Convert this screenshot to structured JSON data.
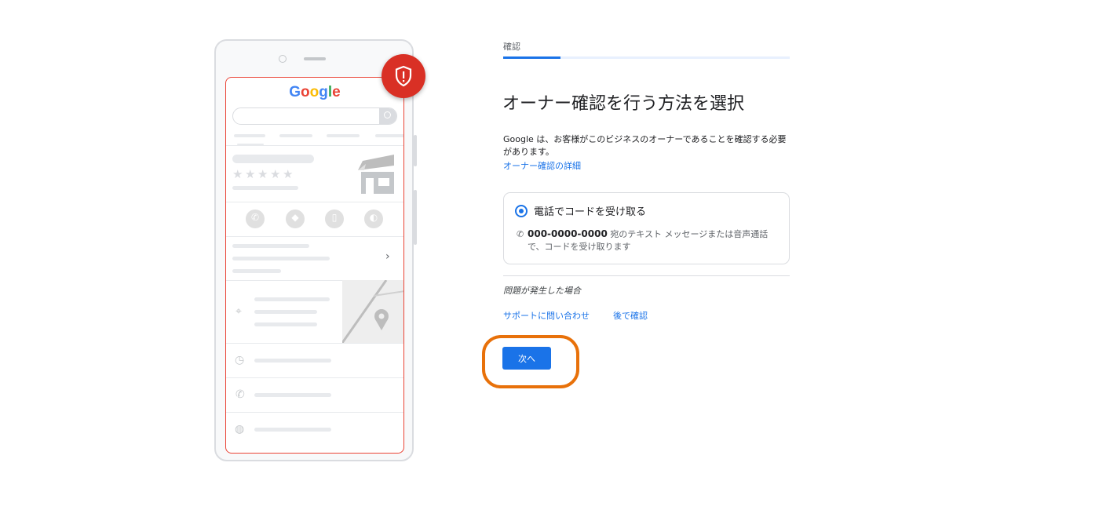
{
  "illustration": {
    "logo_parts": [
      "G",
      "o",
      "o",
      "g",
      "l",
      "e"
    ],
    "stars": [
      "★",
      "★",
      "★",
      "★",
      "★"
    ]
  },
  "verification": {
    "step_label": "確認",
    "progress_value": 0.2,
    "title": "オーナー確認を行う方法を選択",
    "description": "Google は、お客様がこのビジネスのオーナーであることを確認する必要があります。",
    "details_link": "オーナー確認の詳細",
    "option": {
      "label": "電話でコードを受け取る",
      "phone_number": "000-0000-0000",
      "description": "宛のテキスト メッセージまたは音声通話で、コードを受け取ります",
      "selected": true
    },
    "problem_heading": "問題が発生した場合",
    "support_link": "サポートに問い合わせ",
    "later_link": "後で確認",
    "next_button": "次へ"
  },
  "colors": {
    "accent": "#1a73e8",
    "badge": "#d93025",
    "highlight": "#e8710a"
  }
}
